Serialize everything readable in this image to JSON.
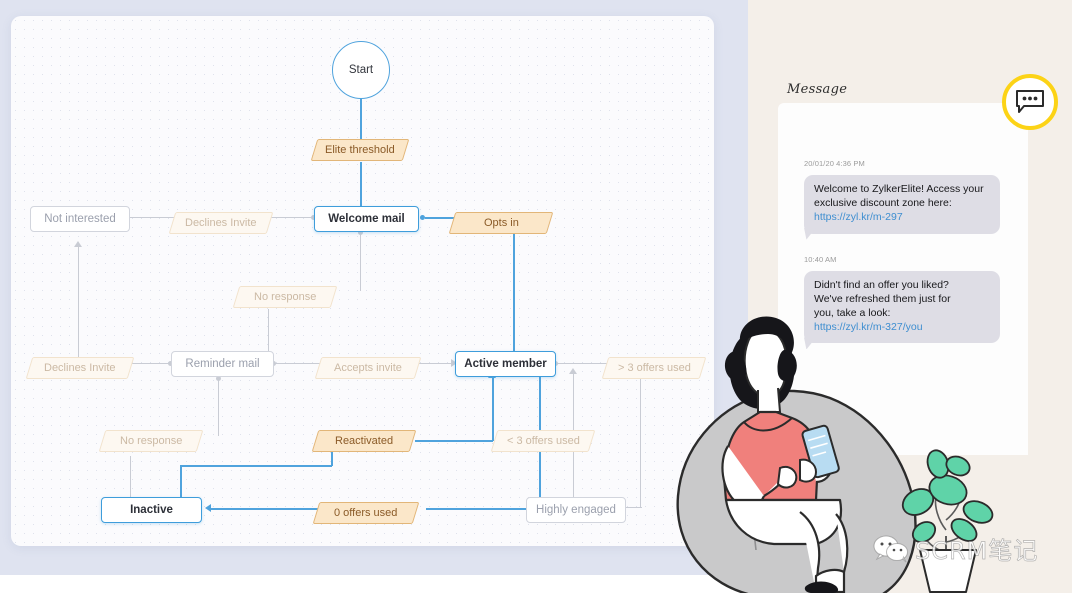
{
  "left_panel": {
    "name": "customer-journey-flowchart",
    "nodes": [
      {
        "id": "start",
        "label": "Start",
        "state": "active"
      },
      {
        "id": "welcome-mail",
        "label": "Welcome mail",
        "state": "active"
      },
      {
        "id": "not-interested",
        "label": "Not interested",
        "state": "dim"
      },
      {
        "id": "reminder-mail",
        "label": "Reminder mail",
        "state": "dim"
      },
      {
        "id": "active-member",
        "label": "Active member",
        "state": "active"
      },
      {
        "id": "inactive",
        "label": "Inactive",
        "state": "active"
      },
      {
        "id": "highly-engaged",
        "label": "Highly engaged",
        "state": "dim"
      }
    ],
    "conditions": [
      {
        "id": "elite-threshold",
        "label": "Elite threshold",
        "state": "active"
      },
      {
        "id": "declines-invite-1",
        "label": "Declines Invite",
        "state": "dim"
      },
      {
        "id": "opts-in",
        "label": "Opts in",
        "state": "active"
      },
      {
        "id": "no-response-1",
        "label": "No response",
        "state": "dim"
      },
      {
        "id": "declines-invite-2",
        "label": "Declines Invite",
        "state": "dim"
      },
      {
        "id": "accepts-invite",
        "label": "Accepts invite",
        "state": "dim"
      },
      {
        "id": "gt-3-offers-used",
        "label": "> 3 offers used",
        "state": "dim"
      },
      {
        "id": "no-response-2",
        "label": "No response",
        "state": "dim"
      },
      {
        "id": "reactivated",
        "label": "Reactivated",
        "state": "active"
      },
      {
        "id": "lt-3-offers-used",
        "label": "< 3 offers used",
        "state": "dim"
      },
      {
        "id": "zero-offers-used",
        "label": "0 offers used",
        "state": "active"
      }
    ],
    "colors": {
      "canvas_bg": "#fbfbfd",
      "panel_bg": "#dfe3f0",
      "active_stroke": "#4fa3dd",
      "dim_stroke": "#c9ccd4",
      "chip_active_fill": "#fbe7c9",
      "chip_active_stroke": "#e2b678",
      "chip_dim_fill": "#fdf8f1"
    }
  },
  "right_panel": {
    "section_label": "Message",
    "badge_icon": "chat-bubble-ellipsis-icon",
    "badge_color": "#fcd316",
    "messages": [
      {
        "timestamp": "20/01/20 4:36 PM",
        "line1": "Welcome to ZylkerElite! Access your",
        "line2": "exclusive discount zone here:",
        "link": "https://zyl.kr/m-297"
      },
      {
        "timestamp": "10:40 AM",
        "line1": "Didn't find an offer you liked?",
        "line2": "We've refreshed them just for",
        "line3": "you, take a look:",
        "link": "https://zyl.kr/m-327/you"
      }
    ],
    "colors": {
      "panel_bg": "#f4efe9",
      "sheet_bg": "#fdfdfd",
      "bubble_bg": "#dedde5",
      "link": "#3e8ed0"
    }
  },
  "illustration": {
    "name": "woman-on-beanbag-with-phone",
    "plant": "potted-plant"
  },
  "watermark": {
    "icon": "wechat-logo-icon",
    "text": "SCRM笔记"
  }
}
